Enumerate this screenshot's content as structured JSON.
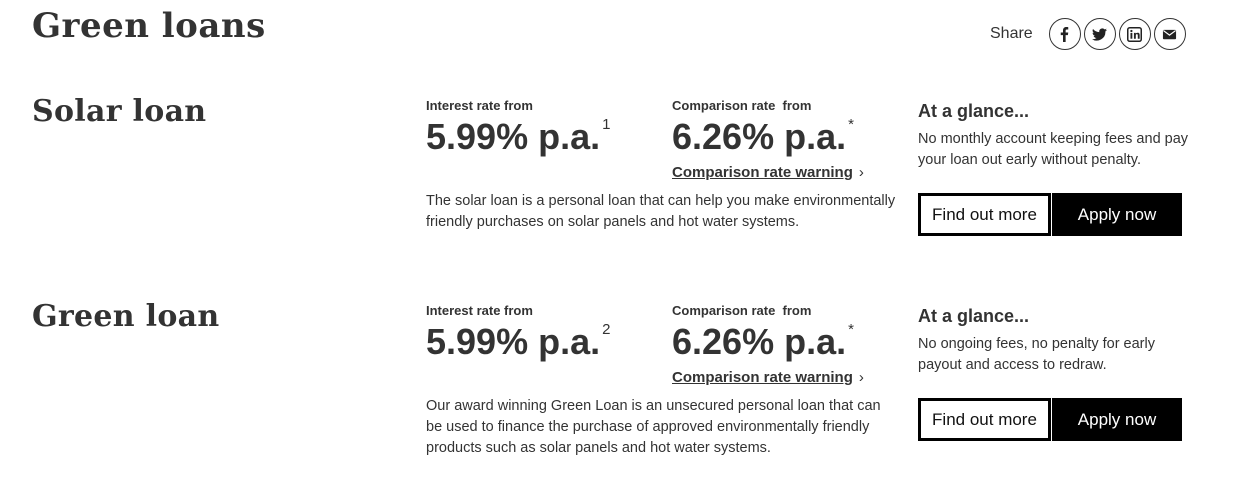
{
  "page": {
    "title": "Green loans"
  },
  "share": {
    "label": "Share",
    "icons": [
      "facebook-icon",
      "twitter-icon",
      "linkedin-icon",
      "email-icon"
    ]
  },
  "loans": [
    {
      "name": "Solar loan",
      "interest_label": "Interest rate from",
      "interest_value": "5.99% p.a.",
      "interest_sup": "1",
      "comparison_label": "Comparison rate  from",
      "comparison_value": "6.26% p.a.",
      "comparison_sup": "*",
      "warning_link": "Comparison rate warning",
      "warning_chevron": "›",
      "description": "The solar loan is a personal loan that can help you make environmentally friendly purchases on solar panels and hot water systems.",
      "glance_title": "At a glance...",
      "glance_text": "No monthly account keeping fees and pay your loan out early without penalty.",
      "find_out_more": "Find out more",
      "apply_now": "Apply now"
    },
    {
      "name": "Green loan",
      "interest_label": "Interest rate from",
      "interest_value": "5.99% p.a.",
      "interest_sup": "2",
      "comparison_label": "Comparison rate  from",
      "comparison_value": "6.26% p.a.",
      "comparison_sup": "*",
      "warning_link": "Comparison rate warning",
      "warning_chevron": "›",
      "description": "Our award winning Green Loan is an unsecured personal loan that can be used to finance the purchase of approved environmentally friendly products such as solar panels and hot water systems.",
      "glance_title": "At a glance...",
      "glance_text": "No ongoing fees, no penalty for early payout and access to redraw.",
      "find_out_more": "Find out more",
      "apply_now": "Apply now"
    }
  ],
  "colors": {
    "text": "#333333",
    "button_dark": "#000000",
    "button_light": "#ffffff"
  }
}
